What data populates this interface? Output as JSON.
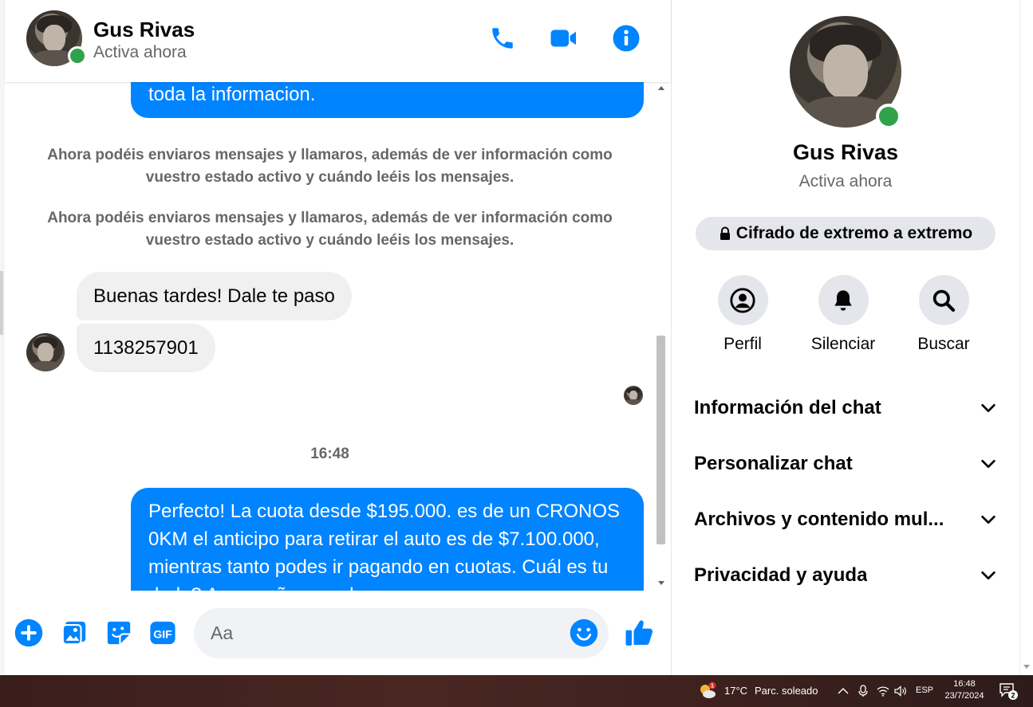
{
  "header": {
    "name": "Gus Rivas",
    "status": "Activa ahora"
  },
  "messages": {
    "outgoing_1": "toda la informacion.",
    "system_1": "Ahora podéis enviaros mensajes y llamaros, además de ver información como vuestro estado activo y cuándo leéis los mensajes.",
    "system_2": "Ahora podéis enviaros mensajes y llamaros, además de ver información como vuestro estado activo y cuándo leéis los mensajes.",
    "incoming_1": "Buenas tardes! Dale te paso",
    "incoming_2": "1138257901",
    "timestamp": "16:48",
    "outgoing_2": "Perfecto! La cuota desde $195.000. es de un CRONOS 0KM el anticipo para retirar el auto es de $7.100.000, mientras tanto podes ir pagando en cuotas. Cuál es tu duda? Acompañamos el"
  },
  "composer": {
    "placeholder": "Aa"
  },
  "info": {
    "name": "Gus Rivas",
    "status": "Activa ahora",
    "encryption": "Cifrado de extremo a extremo",
    "actions": {
      "profile": "Perfil",
      "mute": "Silenciar",
      "search": "Buscar"
    },
    "sections": [
      "Información del chat",
      "Personalizar chat",
      "Archivos y contenido mul...",
      "Privacidad y ayuda"
    ]
  },
  "taskbar": {
    "weather_temp": "17°C",
    "weather_desc": "Parc. soleado",
    "weather_badge": "1",
    "language": "ESP",
    "time": "16:48",
    "date": "23/7/2024",
    "notifications": "2"
  },
  "colors": {
    "accent": "#0084ff",
    "online": "#31a24c",
    "bubble_in": "#f0f0f0",
    "secondary_text": "#65676b"
  },
  "icons": {
    "call": "phone-icon",
    "video": "video-camera-icon",
    "info": "info-icon",
    "plus": "plus-circle-icon",
    "image": "image-icon",
    "sticker": "sticker-icon",
    "gif": "gif-icon",
    "emoji": "emoji-icon",
    "like": "thumbs-up-icon",
    "lock": "lock-icon",
    "profile": "user-circle-icon",
    "mute": "bell-icon",
    "search": "search-icon",
    "chevron": "chevron-down-icon"
  }
}
